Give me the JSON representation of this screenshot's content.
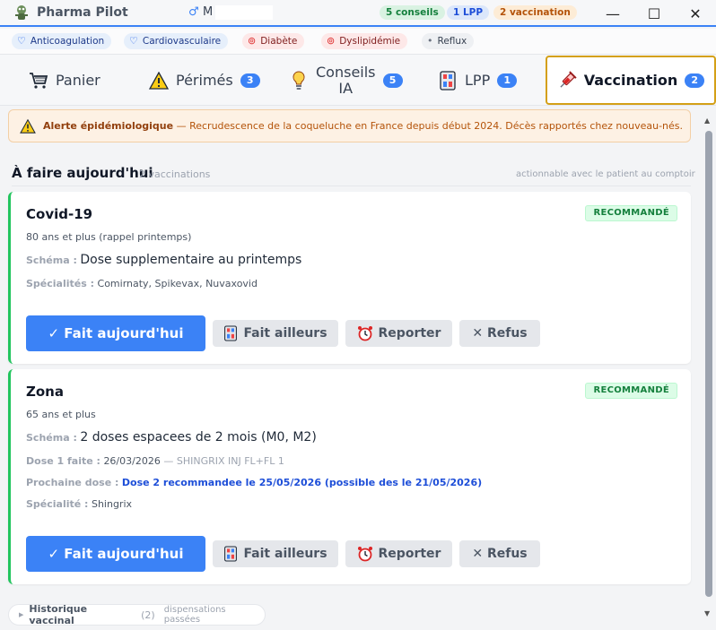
{
  "app": {
    "title": "Pharma Pilot",
    "patient_gender_icon": "♂",
    "patient_initial": "M",
    "badges": [
      "5 conseils",
      "1 LPP",
      "2 vaccination"
    ],
    "window_controls": [
      "—",
      "☐",
      "✕"
    ]
  },
  "conditions": [
    {
      "label": "Anticoagulation",
      "icon": "heart-icon",
      "color": "blue"
    },
    {
      "label": "Cardiovasculaire",
      "icon": "heart-icon",
      "color": "blue"
    },
    {
      "label": "Diabète",
      "icon": "target-icon",
      "color": "red"
    },
    {
      "label": "Dyslipidémie",
      "icon": "target-icon",
      "color": "red"
    },
    {
      "label": "Reflux",
      "icon": "dot-icon",
      "color": "grey"
    }
  ],
  "tabs": [
    {
      "label": "Panier",
      "icon": "cart-icon",
      "count": ""
    },
    {
      "label": "Périmés",
      "icon": "warning-icon",
      "count": "3"
    },
    {
      "label_line1": "Conseils",
      "label_line2": "IA",
      "icon": "lightbulb-icon",
      "count": "5"
    },
    {
      "label": "LPP",
      "icon": "device-icon",
      "count": "1"
    },
    {
      "label": "Vaccination",
      "icon": "syringe-icon",
      "count": "2",
      "active": true
    }
  ],
  "alert": {
    "title": "Alerte épidémiologique",
    "text": "— Recrudescence de la coqueluche en France depuis début 2024. Décès rapportés chez nouveau-nés."
  },
  "section": {
    "title": "À faire aujourd'hui",
    "count": "2 vaccinations",
    "note": "actionnable avec le patient au comptoir"
  },
  "vaccinations": [
    {
      "name": "Covid-19",
      "status": "RECOMMANDÉ",
      "population": "80 ans et plus (rappel printemps)",
      "schema_label": "Schéma :",
      "schema": "Dose supplementaire au printemps",
      "specialites_label": "Spécialités :",
      "specialites": "Comirnaty, Spikevax, Nuvaxovid"
    },
    {
      "name": "Zona",
      "status": "RECOMMANDÉ",
      "population": "65 ans et plus",
      "schema_label": "Schéma :",
      "schema": "2 doses espacees de 2 mois (M0, M2)",
      "dose1_label": "Dose 1 faite :",
      "dose1_date": "26/03/2026",
      "dose1_product": "— SHINGRIX INJ FL+FL 1",
      "next_label": "Prochaine dose :",
      "next_value": "Dose 2 recommandee le 25/05/2026 (possible des le 21/05/2026)",
      "specialites_label": "Spécialité :",
      "specialites": "Shingrix"
    }
  ],
  "buttons": {
    "done": "✓ Fait aujourd'hui",
    "elsewhere": "Fait ailleurs",
    "postpone": "Reporter",
    "refuse": "✕ Refus"
  },
  "history": {
    "title": "Historique vaccinal",
    "count": "(2)",
    "subtitle": "dispensations passées"
  }
}
